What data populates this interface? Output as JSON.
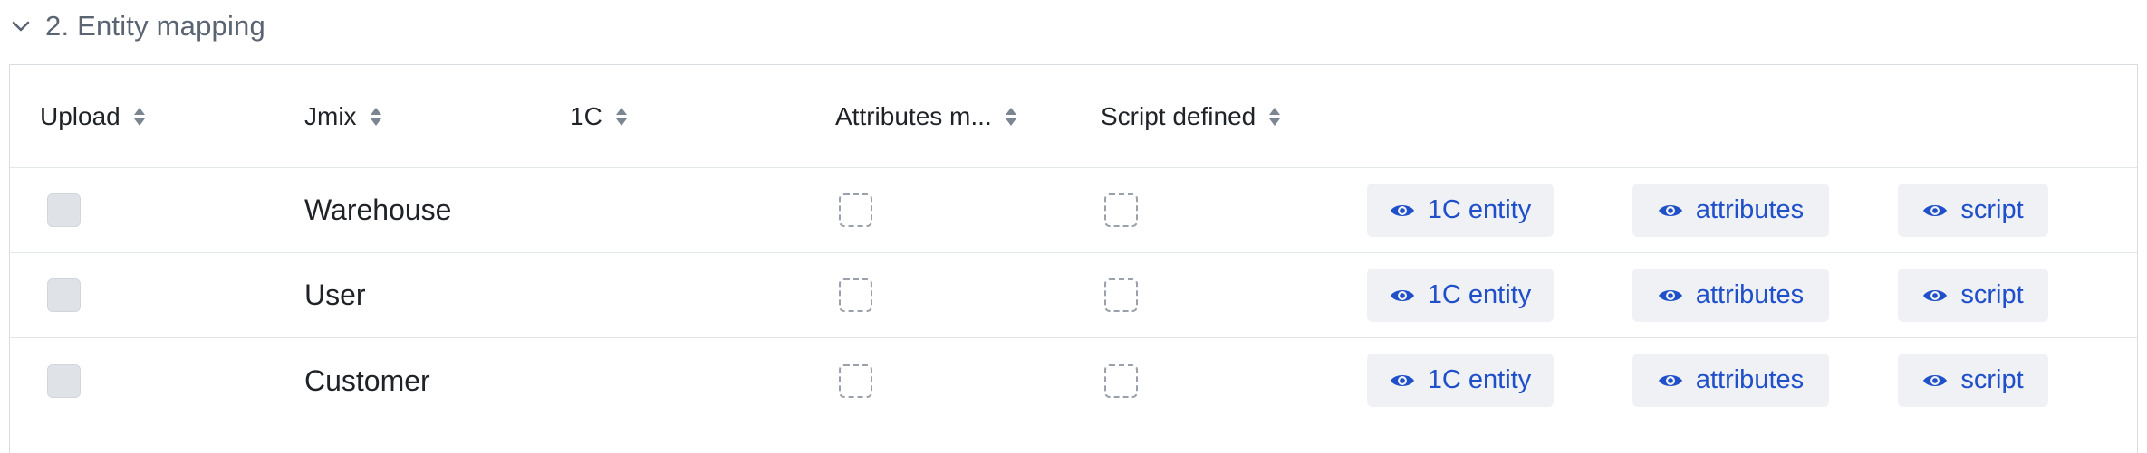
{
  "section": {
    "title": "2. Entity mapping",
    "expanded": true,
    "toggle_icon": "chevron-down-icon"
  },
  "columns": {
    "upload": "Upload",
    "jmix": "Jmix",
    "onec": "1C",
    "attributes": "Attributes m...",
    "script": "Script defined",
    "sort_icon": "sort-icon"
  },
  "rows": [
    {
      "upload": false,
      "jmix": "Warehouse",
      "onec": "",
      "attributes_mapped": false,
      "script_defined": false,
      "entity_button": "1C entity",
      "attributes_button": "attributes",
      "script_button": "script"
    },
    {
      "upload": false,
      "jmix": "User",
      "onec": "",
      "attributes_mapped": false,
      "script_defined": false,
      "entity_button": "1C entity",
      "attributes_button": "attributes",
      "script_button": "script"
    },
    {
      "upload": false,
      "jmix": "Customer",
      "onec": "",
      "attributes_mapped": false,
      "script_defined": false,
      "entity_button": "1C entity",
      "attributes_button": "attributes",
      "script_button": "script"
    }
  ],
  "colors": {
    "button_text": "#1f4fc9",
    "button_bg": "#eff1f5",
    "title": "#5a6472",
    "border": "#d9dde3"
  },
  "icons": {
    "view_button_icon": "eye-icon"
  }
}
